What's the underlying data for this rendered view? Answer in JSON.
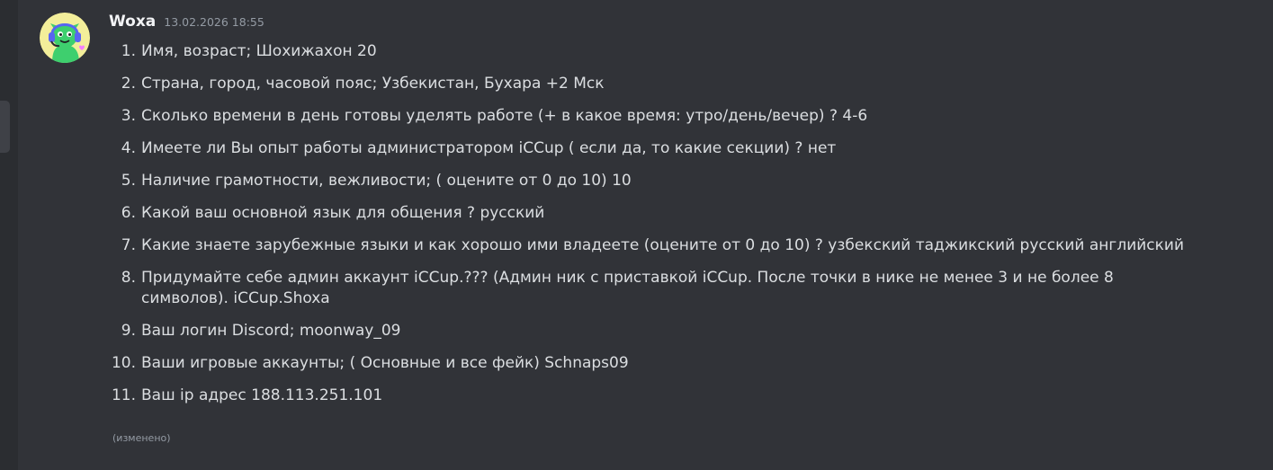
{
  "message": {
    "author": "Woxa",
    "timestamp": "13.02.2026 18:55",
    "edited_label": "(изменено)",
    "items": [
      {
        "num": "1.",
        "text": "Имя, возраст; Шохижахон 20"
      },
      {
        "num": "2.",
        "text": "Страна, город, часовой пояс; Узбекистан, Бухара +2  Мск"
      },
      {
        "num": "3.",
        "text": "Сколько времени в день готовы уделять работе (+ в какое время: утро/день/вечер) ? 4-6"
      },
      {
        "num": "4.",
        "text": "Имеете ли Вы опыт работы администратором iCCup ( если да, то какие секции) ? нет"
      },
      {
        "num": "5.",
        "text": "Наличие грамотности, вежливости; ( оцените от 0 до 10) 10"
      },
      {
        "num": "6.",
        "text": "Какой ваш основной язык для общения ? русский"
      },
      {
        "num": "7.",
        "text": "Какие знаете зарубежные языки и как хорошо ими владеете (оцените от 0 до 10) ? узбекский таджикский русский английский"
      },
      {
        "num": "8.",
        "text": "Придумайте себе админ аккаунт iCCup.??? (Админ ник с приставкой iCCup. После точки в нике не менее 3 и не более 8 символов). iCCup.Shoxa"
      },
      {
        "num": "9.",
        "text": "Ваш логин Discord; moonway_09"
      },
      {
        "num": "10.",
        "text": "Ваши игровые аккаунты; ( Основные и все фейк) Schnaps09"
      },
      {
        "num": "11.",
        "text": "Ваш ip адрес  188.113.251.101"
      }
    ]
  },
  "avatar": {
    "icon": "green-creature-headset-avatar",
    "background_color": "#f3ee9a",
    "body_color": "#3ecf6e",
    "headset_color": "#5865f2"
  },
  "colors": {
    "background": "#313338",
    "text": "#dbdee1",
    "username": "#f2f3f5",
    "muted": "#949ba4"
  }
}
